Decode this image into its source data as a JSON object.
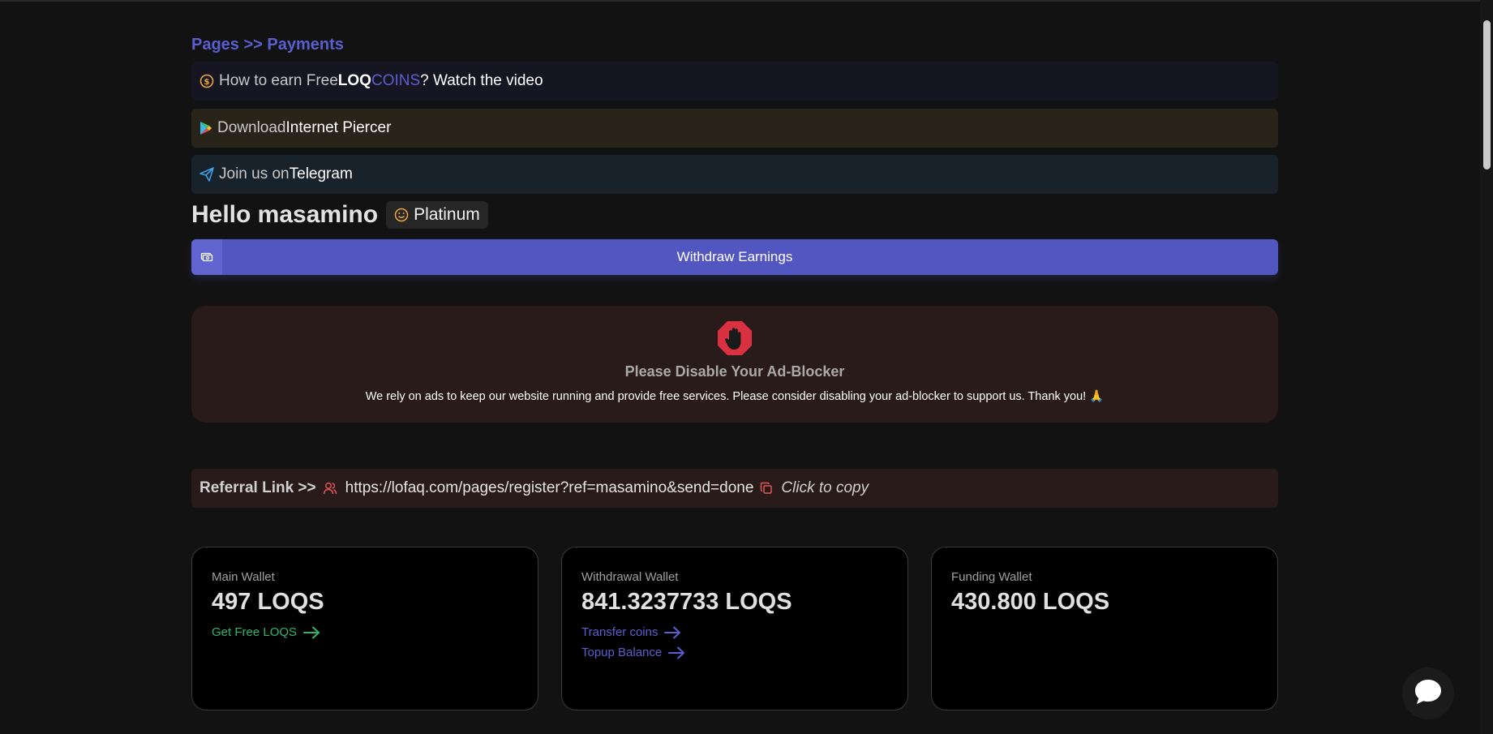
{
  "breadcrumb": "Pages >> Payments",
  "banners": {
    "earn": {
      "prefix": "How to earn Free ",
      "brand_a": "LOQ",
      "brand_b": "COINS",
      "suffix": "? Watch the video"
    },
    "download": {
      "prefix": "Download ",
      "app": "Internet Piercer"
    },
    "telegram": {
      "prefix": "Join us on ",
      "name": "Telegram"
    }
  },
  "greeting": "Hello masamino",
  "tier_badge": "Platinum",
  "withdraw_button": "Withdraw Earnings",
  "adblock": {
    "title": "Please Disable Your Ad-Blocker",
    "message": "We rely on ads to keep our website running and provide free services. Please consider disabling your ad-blocker to support us. Thank you! 🙏"
  },
  "referral": {
    "label": "Referral Link >>",
    "url": "https://lofaq.com/pages/register?ref=masamino&send=done",
    "copy_label": "Click to copy"
  },
  "wallets": [
    {
      "label": "Main Wallet",
      "value": "497 LOQS",
      "links": [
        "Get Free LOQS"
      ]
    },
    {
      "label": "Withdrawal Wallet",
      "value": "841.3237733 LOQS",
      "links": [
        "Transfer coins",
        "Topup Balance"
      ]
    },
    {
      "label": "Funding Wallet",
      "value": "430.800 LOQS",
      "links": []
    }
  ],
  "colors": {
    "accent": "#5156c0",
    "brand_blue": "#5a5fd0",
    "green_link": "#2fb56a",
    "stop_red": "#d9313f",
    "background": "#121212"
  },
  "icons": {
    "earn": "coin-icon",
    "download": "play-store-icon",
    "telegram": "paper-plane-icon",
    "badge": "smiley-icon",
    "withdraw": "cash-icon",
    "adblock": "stop-hand-icon",
    "referral": "users-icon",
    "copy": "copy-icon",
    "chat": "chat-bubble-icon"
  }
}
